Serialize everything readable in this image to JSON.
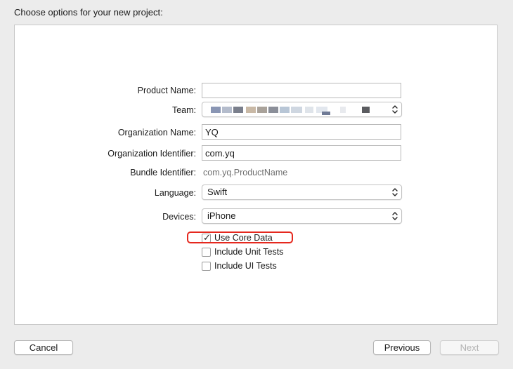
{
  "header": {
    "title": "Choose options for your new project:"
  },
  "form": {
    "product_name": {
      "label": "Product Name:",
      "value": ""
    },
    "team": {
      "label": "Team:"
    },
    "organization_name": {
      "label": "Organization Name:",
      "value": "YQ"
    },
    "organization_identifier": {
      "label": "Organization Identifier:",
      "value": "com.yq"
    },
    "bundle_identifier": {
      "label": "Bundle Identifier:",
      "value": "com.yq.ProductName"
    },
    "language": {
      "label": "Language:",
      "value": "Swift"
    },
    "devices": {
      "label": "Devices:",
      "value": "iPhone"
    },
    "checkboxes": [
      {
        "label": "Use Core Data",
        "checked": true
      },
      {
        "label": "Include Unit Tests",
        "checked": false
      },
      {
        "label": "Include UI Tests",
        "checked": false
      }
    ]
  },
  "footer": {
    "cancel_label": "Cancel",
    "previous_label": "Previous",
    "next_label": "Next"
  },
  "colors": {
    "highlight": "#e5281e",
    "disabled_text": "#b3b3b3"
  }
}
